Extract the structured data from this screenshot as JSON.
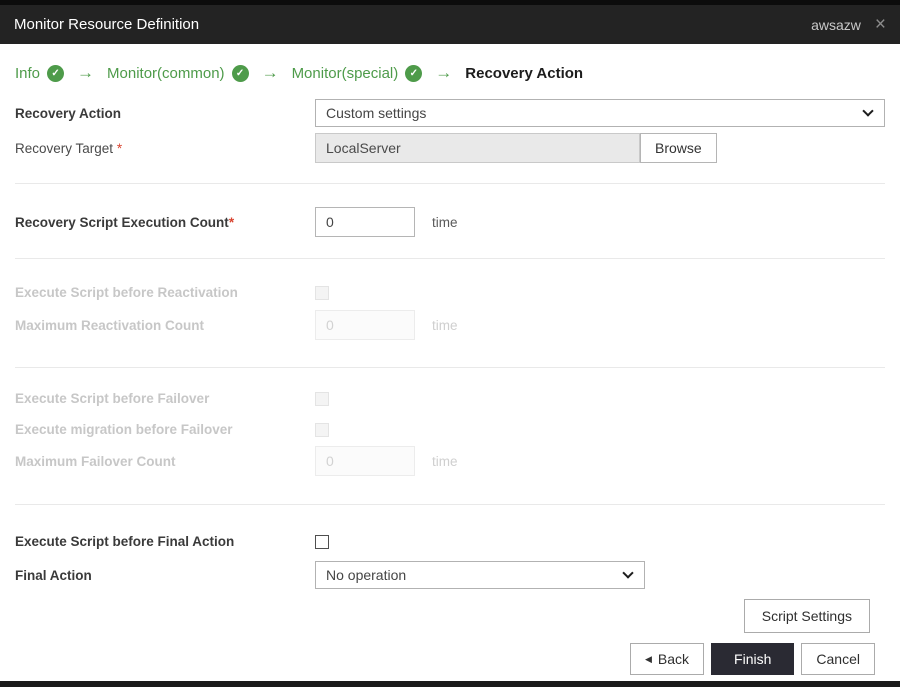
{
  "colors": {
    "header_bg": "#232323",
    "accent_green": "#4e9b4a",
    "finish_button_bg": "#2a2a33",
    "required_red": "#d9432f",
    "disabled_text": "#c7c7c7"
  },
  "icons": {
    "check": "✓",
    "arrow": "→",
    "close": "×",
    "back_triangle": "◀"
  },
  "header": {
    "title": "Monitor Resource Definition",
    "resource_name": "awsazw"
  },
  "steps": {
    "items": [
      {
        "label": "Info",
        "completed": true
      },
      {
        "label": "Monitor(common)",
        "completed": true
      },
      {
        "label": "Monitor(special)",
        "completed": true
      },
      {
        "label": "Recovery Action",
        "completed": false,
        "current": true
      }
    ]
  },
  "form": {
    "recovery_action": {
      "label": "Recovery Action",
      "value": "Custom settings"
    },
    "recovery_target": {
      "label": "Recovery Target ",
      "required_mark": "*",
      "value": "LocalServer",
      "browse_label": "Browse"
    },
    "recovery_script_execution_count": {
      "label": "Recovery Script Execution Count",
      "required_mark": "*",
      "value": "0",
      "unit": "time"
    },
    "execute_script_before_reactivation": {
      "label": "Execute Script before Reactivation",
      "checked": false,
      "disabled": true
    },
    "maximum_reactivation_count": {
      "label": "Maximum Reactivation Count",
      "value": "0",
      "unit": "time",
      "disabled": true
    },
    "execute_script_before_failover": {
      "label": "Execute Script before Failover",
      "checked": false,
      "disabled": true
    },
    "execute_migration_before_failover": {
      "label": "Execute migration before Failover",
      "checked": false,
      "disabled": true
    },
    "maximum_failover_count": {
      "label": "Maximum Failover Count",
      "value": "0",
      "unit": "time",
      "disabled": true
    },
    "execute_script_before_final_action": {
      "label": "Execute Script before Final Action",
      "checked": false
    },
    "final_action": {
      "label": "Final Action",
      "value": "No operation"
    }
  },
  "footer": {
    "script_settings": "Script Settings",
    "back": "Back",
    "finish": "Finish",
    "cancel": "Cancel"
  }
}
